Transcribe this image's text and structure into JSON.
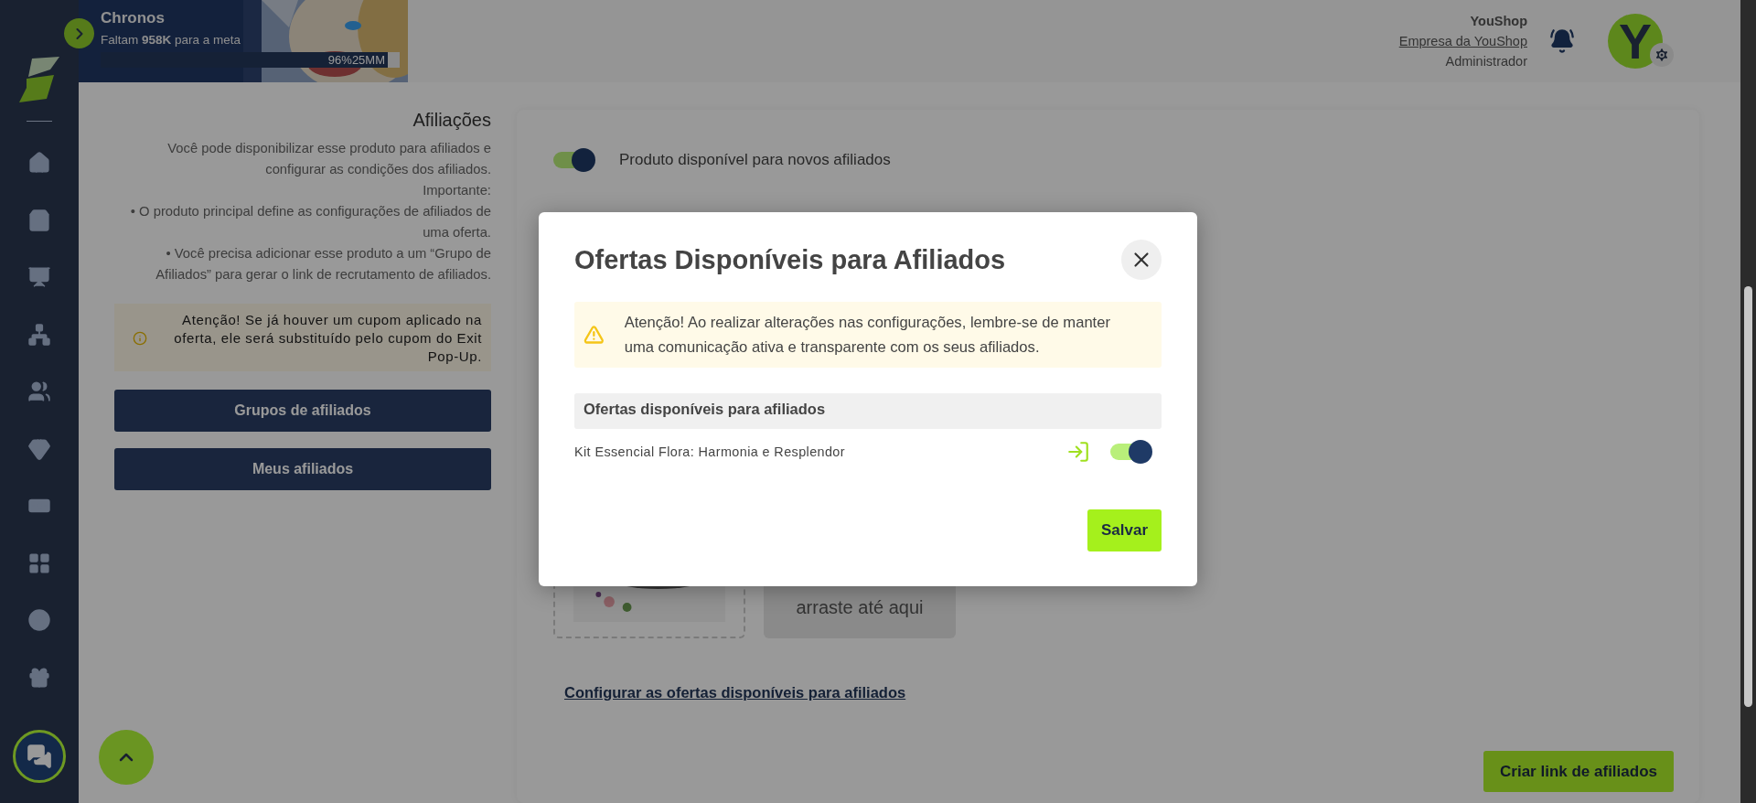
{
  "banner": {
    "kind": "picture",
    "title": "Chronos",
    "subtitle": "Faltam **958K** para a meta",
    "progress": {
      "level": 0.96,
      "percent": "96%",
      "goal": "25MM"
    }
  },
  "account": {
    "store": "YouShop",
    "company": "Empresa da YouShop",
    "role": "Administrador",
    "avatar_letter": "Y"
  },
  "affiliations": {
    "title": "Afiliações",
    "paragraphs": [
      "Você pode disponibilizar esse produto para afiliados e configurar as condições dos afiliados.",
      "Importante:",
      "• O produto principal define as configurações de afiliados de uma oferta.",
      "• Você precisa adicionar esse produto a um “Grupo de Afiliados” para gerar o link de recrutamento de afiliados."
    ],
    "notice": "Atenção! Se já houver um cupom aplicado na oferta, ele será substituído pelo cupom do Exit Pop-Up.",
    "buttons": [
      "Grupos de afiliados",
      "Meus afiliados"
    ]
  },
  "main": {
    "toggle": {
      "label": "Produto disponível para novos afiliados",
      "on": true
    },
    "dropzone": {
      "text": "arraste até aqui"
    },
    "link": "Configurar as ofertas disponíveis para afiliados",
    "create_button": "Criar link de afiliados"
  },
  "modal": {
    "title": "Ofertas Disponíveis para Afiliados",
    "warning": "Atenção! Ao realizar alterações nas configurações, lembre-se de manter uma comunicação ativa e transparente com os seus afiliados.",
    "table": {
      "header": "Ofertas disponíveis para afiliados",
      "rows": [
        {
          "name": "Kit Essencial Flora: Harmonia e Resplendor",
          "on": true
        }
      ]
    },
    "save_button": "Salvar"
  }
}
